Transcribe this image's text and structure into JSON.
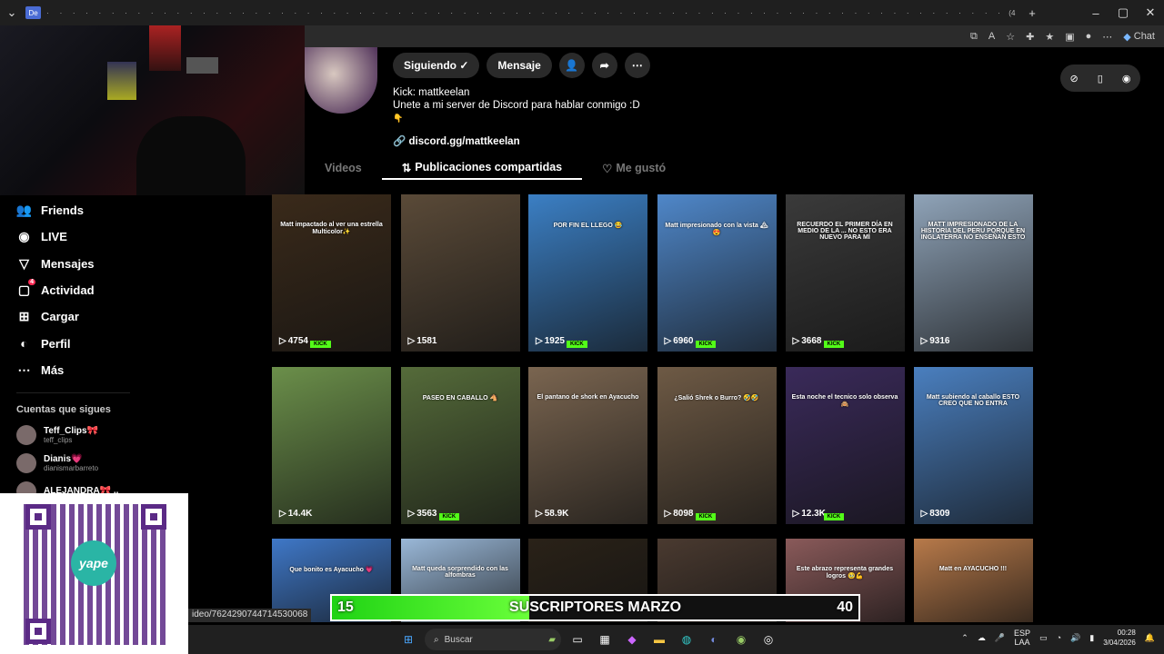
{
  "browser": {
    "active_tab_label": "De",
    "last_tab_label": "(4",
    "chat_label": "Chat",
    "status_url": "ideo/7624290744714530068"
  },
  "profile": {
    "following_label": "Siguiendo",
    "message_label": "Mensaje",
    "bio_line1": "Kick: mattkeelan",
    "bio_line2": "Unete a mi server de Discord para hablar conmigo :D",
    "link": "discord.gg/mattkeelan"
  },
  "tabs": [
    {
      "label": "Videos"
    },
    {
      "label": "Publicaciones compartidas"
    },
    {
      "label": "Me gustó"
    }
  ],
  "sidebar": {
    "items": [
      {
        "label": "Friends",
        "icon": "friends-icon"
      },
      {
        "label": "LIVE",
        "icon": "live-icon"
      },
      {
        "label": "Mensajes",
        "icon": "messages-icon"
      },
      {
        "label": "Actividad",
        "icon": "activity-icon",
        "badge": "4"
      },
      {
        "label": "Cargar",
        "icon": "upload-icon"
      },
      {
        "label": "Perfil",
        "icon": "profile-icon"
      },
      {
        "label": "Más",
        "icon": "more-icon"
      }
    ],
    "following_title": "Cuentas que sigues",
    "following": [
      {
        "name": "Teff_Clips🎀",
        "handle": "teff_clips"
      },
      {
        "name": "Dianis💗",
        "handle": "dianismarbarreto"
      },
      {
        "name": "ALEJANDRA🎀 ..",
        "handle": ""
      }
    ]
  },
  "videos": [
    {
      "views": "4754",
      "caption": "Matt impactado al ver una estrella Multicolor✨",
      "kick": true,
      "bg": "#3a2a1a"
    },
    {
      "views": "1581",
      "caption": "",
      "kick": false,
      "bg": "#5a4a38"
    },
    {
      "views": "1925",
      "caption": "POR FIN EL LLEGO 😂",
      "kick": true,
      "bg": "#3b7fc4"
    },
    {
      "views": "6960",
      "caption": "Matt impresionado con la vista 🏔😍",
      "kick": true,
      "bg": "#4f87c9"
    },
    {
      "views": "3668",
      "caption": "RECUERDO EL PRIMER DÍA EN MEDIO DE LA ... NO ESTO ERA NUEVO PARA MÍ",
      "kick": true,
      "bg": "#3a3a3a"
    },
    {
      "views": "9316",
      "caption": "MATT IMPRESIONADO DE LA HISTORIA DEL PERU PORQUE EN INGLATERRA NO ENSEÑAN ESTO",
      "kick": false,
      "bg": "#8fa3b8"
    },
    {
      "views": "14.4K",
      "caption": "",
      "kick": false,
      "bg": "#6b8f4a"
    },
    {
      "views": "3563",
      "caption": "PASEO EN CABALLO 🐴",
      "kick": true,
      "bg": "#556b3a"
    },
    {
      "views": "58.9K",
      "caption": "El pantano de shork en Ayacucho",
      "kick": false,
      "bg": "#7a6550"
    },
    {
      "views": "8098",
      "caption": "¿Salió Shrek o Burro? 🤣🤣",
      "kick": true,
      "bg": "#6e5a45"
    },
    {
      "views": "12.3K",
      "caption": "Esta noche el tecnico solo observa 🙈",
      "kick": true,
      "bg": "#3a2a5a"
    },
    {
      "views": "8309",
      "caption": "Matt subiendo al caballo ESTO CREO QUE NO ENTRA",
      "kick": false,
      "bg": "#4a7fbf"
    },
    {
      "views": "",
      "caption": "Que bonito es Ayacucho 💗",
      "kick": false,
      "bg": "#3f78c8"
    },
    {
      "views": "",
      "caption": "Matt queda sorprendido con las alfombras",
      "kick": false,
      "bg": "#9ab8d8"
    },
    {
      "views": "",
      "caption": "",
      "kick": false,
      "bg": "#2a2218"
    },
    {
      "views": "",
      "caption": "",
      "kick": false,
      "bg": "#4a3a30"
    },
    {
      "views": "",
      "caption": "Este abrazo representa grandes logros 🥹💪",
      "kick": false,
      "bg": "#8a5a5a"
    },
    {
      "views": "",
      "caption": "Matt en AYACUCHO !!!",
      "kick": false,
      "bg": "#b87a4a"
    }
  ],
  "subs_goal": {
    "current": "15",
    "label": "SUSCRIPTORES MARZO",
    "target": "40",
    "progress_fraction": 0.375
  },
  "taskbar": {
    "search_placeholder": "Buscar",
    "lang_line1": "ESP",
    "lang_line2": "LAA",
    "time": "00:28",
    "date": "3/04/2026"
  },
  "yape_label": "yape"
}
